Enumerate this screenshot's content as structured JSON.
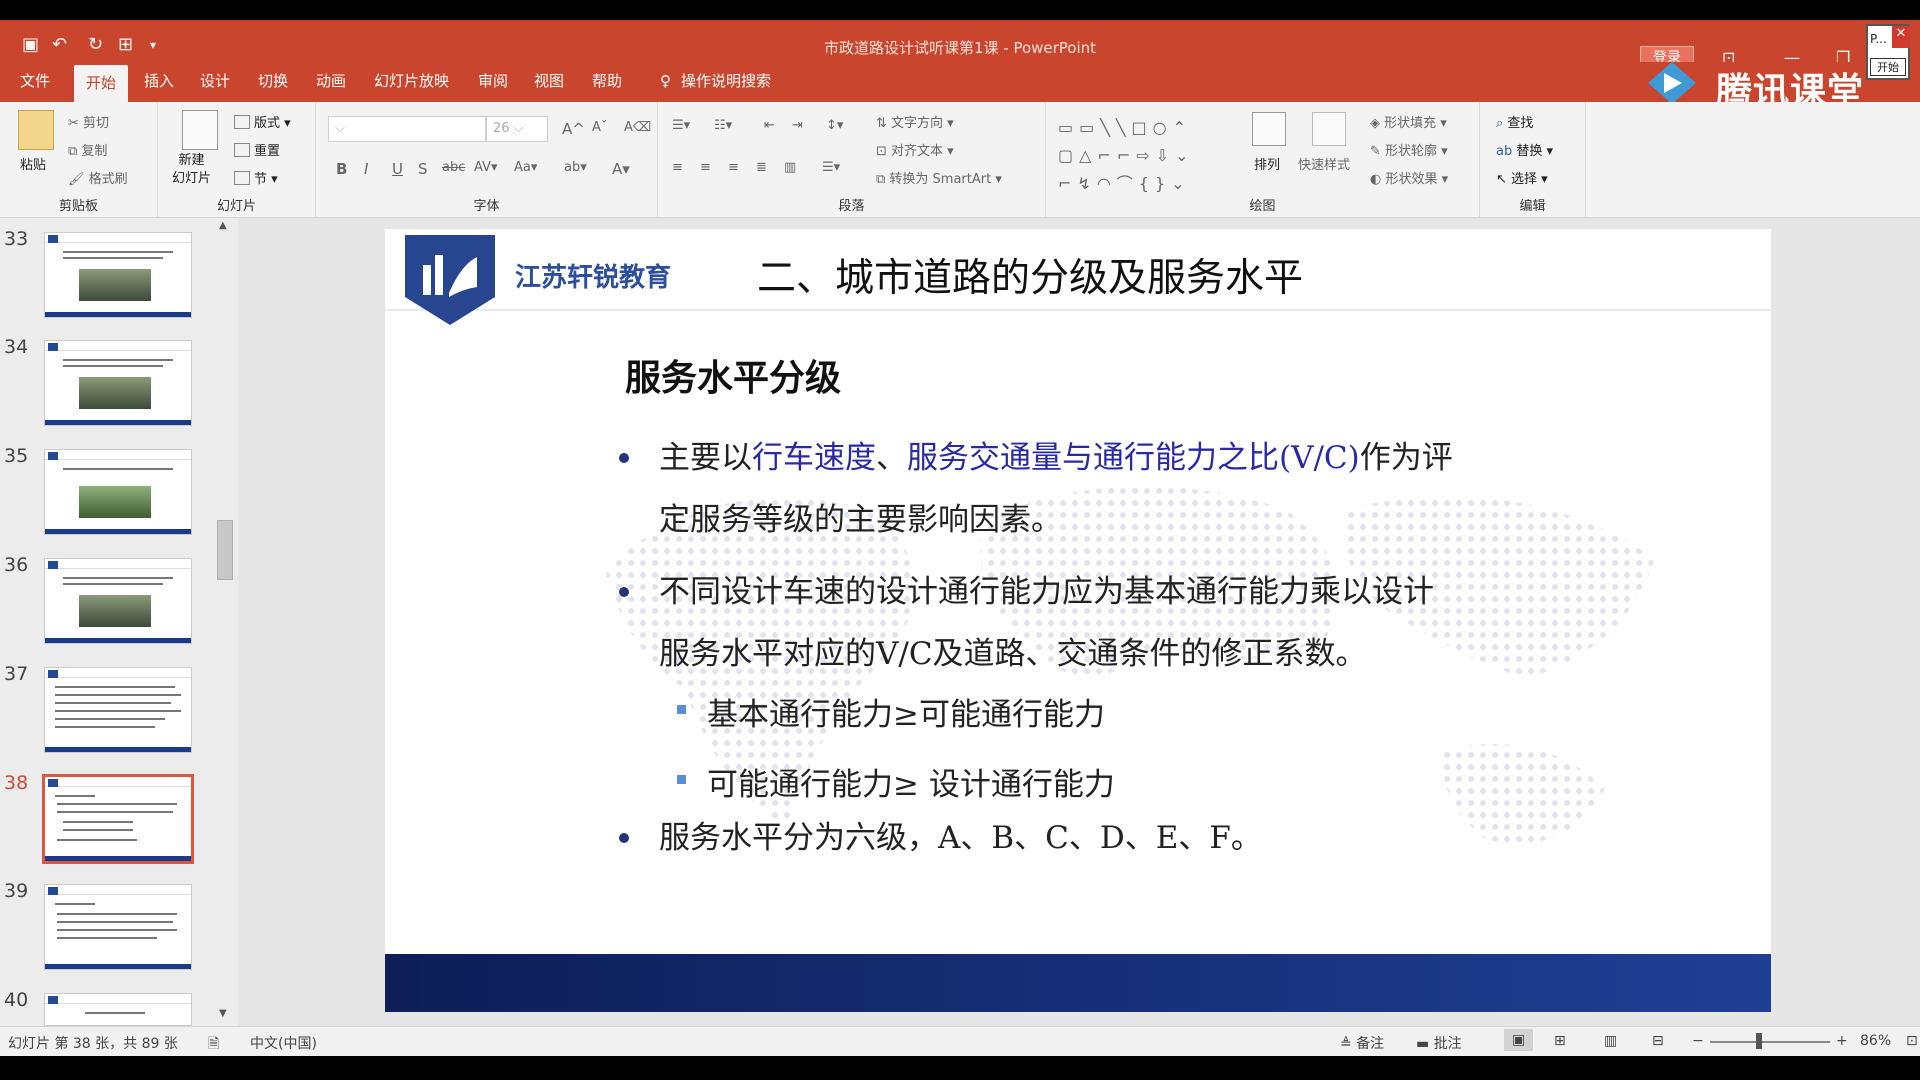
{
  "window": {
    "title": "市政道路设计试听课第1课 - PowerPoint",
    "login": "登录",
    "p_label": "P...",
    "start_label": "开始"
  },
  "tabs": [
    "文件",
    "开始",
    "插入",
    "设计",
    "切换",
    "动画",
    "幻灯片放映",
    "审阅",
    "视图",
    "帮助"
  ],
  "tell_me": "操作说明搜索",
  "watermark": "腾讯课堂",
  "ribbon": {
    "clipboard": {
      "paste": "粘贴",
      "cut": "剪切",
      "copy": "复制",
      "format_painter": "格式刷",
      "label": "剪贴板"
    },
    "slides": {
      "new_slide": "新建\n幻灯片",
      "layout": "版式",
      "reset": "重置",
      "section": "节",
      "label": "幻灯片"
    },
    "font": {
      "size": "26",
      "label": "字体"
    },
    "paragraph": {
      "text_direction": "文字方向",
      "align_text": "对齐文本",
      "smartart": "转换为 SmartArt",
      "label": "段落"
    },
    "drawing": {
      "arrange": "排列",
      "quick_styles": "快速样式",
      "fill": "形状填充",
      "outline": "形状轮廓",
      "effects": "形状效果",
      "label": "绘图"
    },
    "editing": {
      "find": "查找",
      "replace": "替换",
      "select": "选择",
      "label": "编辑"
    }
  },
  "thumbnails": [
    {
      "num": "33",
      "selected": false
    },
    {
      "num": "34",
      "selected": false
    },
    {
      "num": "35",
      "selected": false
    },
    {
      "num": "36",
      "selected": false
    },
    {
      "num": "37",
      "selected": false
    },
    {
      "num": "38",
      "selected": true
    },
    {
      "num": "39",
      "selected": false
    },
    {
      "num": "40",
      "selected": false
    }
  ],
  "slide": {
    "brand": "江苏轩锐教育",
    "title": "二、城市道路的分级及服务水平",
    "subtitle": "服务水平分级",
    "b1": {
      "p1": "主要以",
      "p2": "行车速度",
      "p3": "、",
      "p4": "服务交通量与通行能力之比(V/C)",
      "p5": "作为评",
      "p6": "定服务等级的主要影响因素。"
    },
    "b2": {
      "line1": "不同设计车速的设计通行能力应为基本通行能力乘以设计",
      "line2": "服务水平对应的V/C及道路、交通条件的修正系数。"
    },
    "s1": "基本通行能力≥可能通行能力",
    "s2": "可能通行能力≥ 设计通行能力",
    "b3": "服务水平分为六级，A、B、C、D、E、F。"
  },
  "status": {
    "slide_info": "幻灯片 第 38 张，共 89 张",
    "language": "中文(中国)",
    "notes": "备注",
    "comments": "批注",
    "zoom": "86%"
  },
  "colors": {
    "accent": "#c9452d",
    "brand_blue": "#2d4e9c",
    "highlight_blue": "#2a2aa6",
    "footer_blue": "#1a3a8a"
  }
}
